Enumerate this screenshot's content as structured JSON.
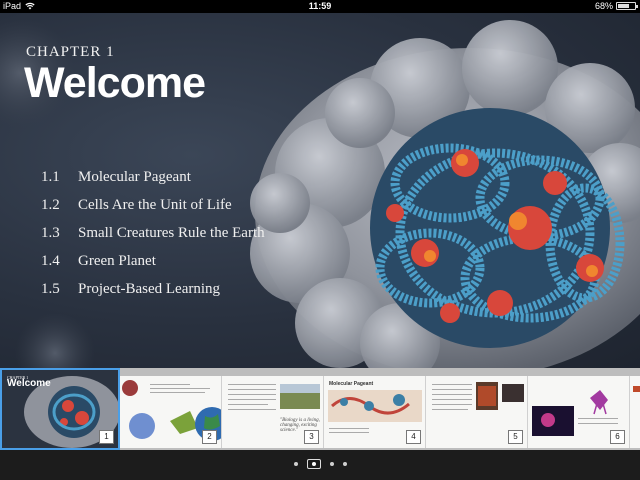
{
  "status_bar": {
    "device": "iPad",
    "time": "11:59",
    "battery_text": "68%",
    "battery_level": 0.68
  },
  "chapter": {
    "label": "CHAPTER 1",
    "title": "Welcome"
  },
  "toc": [
    {
      "number": "1.1",
      "title": "Molecular Pageant"
    },
    {
      "number": "1.2",
      "title": "Cells Are the Unit of Life"
    },
    {
      "number": "1.3",
      "title": "Small Creatures Rule the Earth"
    },
    {
      "number": "1.4",
      "title": "Green Planet"
    },
    {
      "number": "1.5",
      "title": "Project-Based Learning"
    }
  ],
  "thumbnails": {
    "active_chapter": "CHAPTER 1",
    "active_title": "Welcome",
    "pages": [
      "1",
      "2",
      "3",
      "4",
      "5",
      "6"
    ],
    "page4_heading": "Molecular Pageant",
    "page3_quote": "\"Biology is a living, changing, exciting science.\""
  },
  "pager": {
    "page_count": 4,
    "current_index": 1
  },
  "colors": {
    "background": "#29313f",
    "selection_border": "#4a9fe8"
  }
}
